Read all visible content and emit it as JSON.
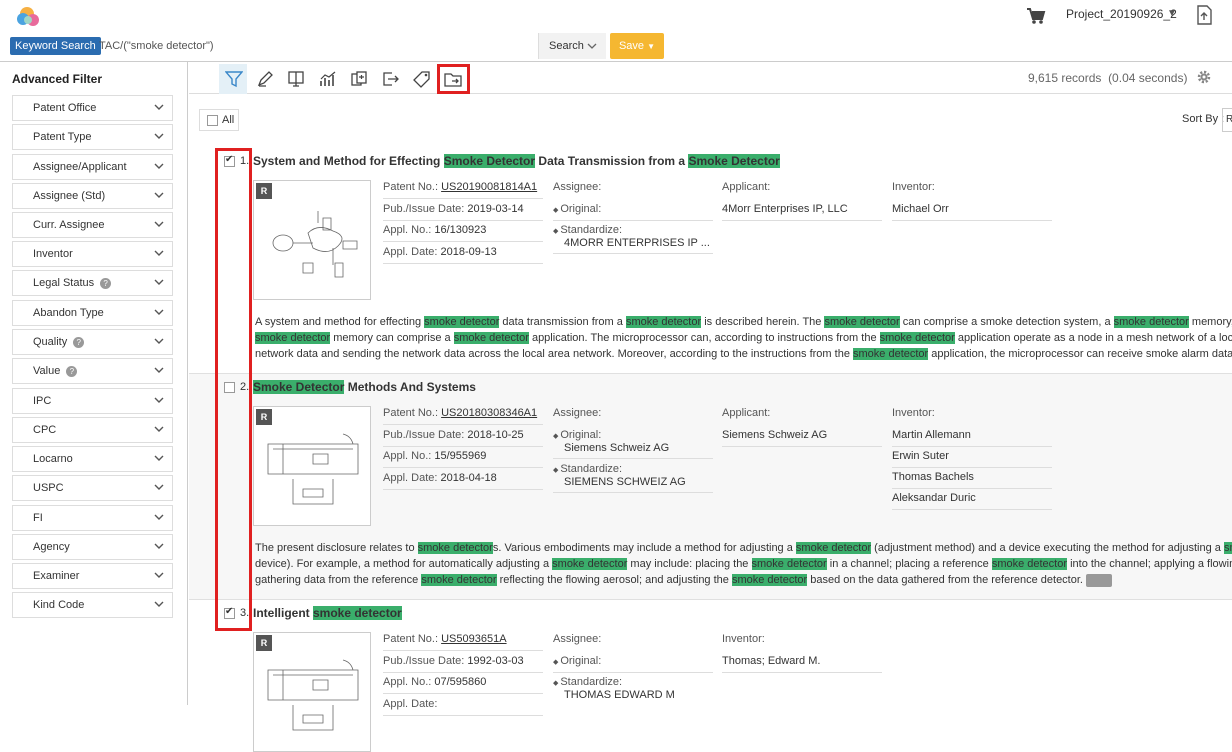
{
  "header": {
    "project": "Project_20190926_2"
  },
  "search": {
    "tag": "Keyword Search",
    "query": "TAC/(\"smoke detector\")",
    "search_label": "Search",
    "save_label": "Save"
  },
  "sidebar": {
    "title": "Advanced Filter",
    "filters": [
      {
        "label": "Patent Office"
      },
      {
        "label": "Patent Type"
      },
      {
        "label": "Assignee/Applicant"
      },
      {
        "label": "Assignee (Std)"
      },
      {
        "label": "Curr. Assignee"
      },
      {
        "label": "Inventor"
      },
      {
        "label": "Legal Status"
      },
      {
        "label": "Abandon Type"
      },
      {
        "label": "Quality"
      },
      {
        "label": "Value"
      },
      {
        "label": "IPC"
      },
      {
        "label": "CPC"
      },
      {
        "label": "Locarno"
      },
      {
        "label": "USPC"
      },
      {
        "label": "FI"
      },
      {
        "label": "Agency"
      },
      {
        "label": "Examiner"
      },
      {
        "label": "Kind Code"
      }
    ]
  },
  "toolbar": {
    "records": "9,615 records",
    "time": "(0.04 seconds)",
    "help_glyph": "?"
  },
  "list": {
    "all_label": "All",
    "sort_label": "Sort By :",
    "sort_value": "R"
  },
  "labels": {
    "badge": "R",
    "patent_no": "Patent No.:",
    "pub_date": "Pub./Issue Date:",
    "appl_no": "Appl. No.:",
    "appl_date": "Appl. Date:",
    "assignee": "Assignee:",
    "original": "Original:",
    "standardize": "Standardize:",
    "applicant": "Applicant:",
    "inventor": "Inventor:"
  },
  "results": [
    {
      "num": "1.",
      "checked": true,
      "title_parts": [
        "System and Method for Effecting ",
        "Smoke Detector",
        " Data Transmission from a ",
        "Smoke Detector"
      ],
      "patent_no": "US20190081814A1",
      "pub_date": "2019-03-14",
      "appl_no": "16/130923",
      "appl_date": "2018-09-13",
      "original": "",
      "standardize": "4MORR ENTERPRISES IP ...",
      "applicant": "4Morr Enterprises IP, LLC",
      "inventors": [
        "Michael Orr"
      ],
      "abstract_lines": [
        [
          "A system and method for effecting ",
          "smoke detector",
          " data transmission from a ",
          "smoke detector",
          " is described herein. The ",
          "smoke detector",
          " can comprise a smoke detection system, a ",
          "smoke detector",
          " memory, and a n"
        ],
        [
          "",
          "smoke detector",
          " memory can comprise a ",
          "smoke detector",
          " application. The microprocessor can, according to instructions from the ",
          "smoke detector",
          " application operate as a node in a mesh network of a local area n"
        ],
        [
          "network data and sending the network data across the local area network. Moreover, according to the instructions from the ",
          "smoke detector",
          " application, the microprocessor can receive smoke alarm data from the"
        ]
      ]
    },
    {
      "num": "2.",
      "checked": false,
      "title_parts": [
        "",
        "Smoke Detector",
        " Methods And Systems"
      ],
      "patent_no": "US20180308346A1",
      "pub_date": "2018-10-25",
      "appl_no": "15/955969",
      "appl_date": "2018-04-18",
      "original": "Siemens Schweiz AG",
      "standardize": "SIEMENS SCHWEIZ AG",
      "applicant": "Siemens Schweiz AG",
      "inventors": [
        "Martin Allemann",
        "Erwin Suter",
        "Thomas Bachels",
        "Aleksandar Duric"
      ],
      "abstract_lines": [
        [
          "The present disclosure relates to ",
          "smoke detector",
          "s. Various embodiments may include a method for adjusting a ",
          "smoke detector",
          " (adjustment method) and a device executing the method for adjusting a ",
          "smoke det",
          ""
        ],
        [
          "device). For example, a method for automatically adjusting a ",
          "smoke detector",
          " may include: placing the ",
          "smoke detector",
          " in a channel; placing a reference ",
          "smoke detector",
          " into the channel; applying a flowing aerosol"
        ],
        [
          "gathering data from the reference ",
          "smoke detector",
          " reflecting the flowing aerosol; and adjusting the ",
          "smoke detector",
          " based on the data gathered from the reference detector."
        ]
      ]
    },
    {
      "num": "3.",
      "checked": true,
      "title_parts": [
        "Intelligent ",
        "smoke detector"
      ],
      "patent_no": "US5093651A",
      "pub_date": "1992-03-03",
      "appl_no": "07/595860",
      "appl_date": "",
      "original": "",
      "standardize": "THOMAS EDWARD M",
      "applicant": "",
      "inventors": [
        "Thomas; Edward M."
      ],
      "abstract_lines": []
    }
  ],
  "colors": {
    "accent": "#2b6cb0",
    "highlight": "#3aae6b",
    "save": "#f5b731",
    "annotation": "#e02020"
  }
}
